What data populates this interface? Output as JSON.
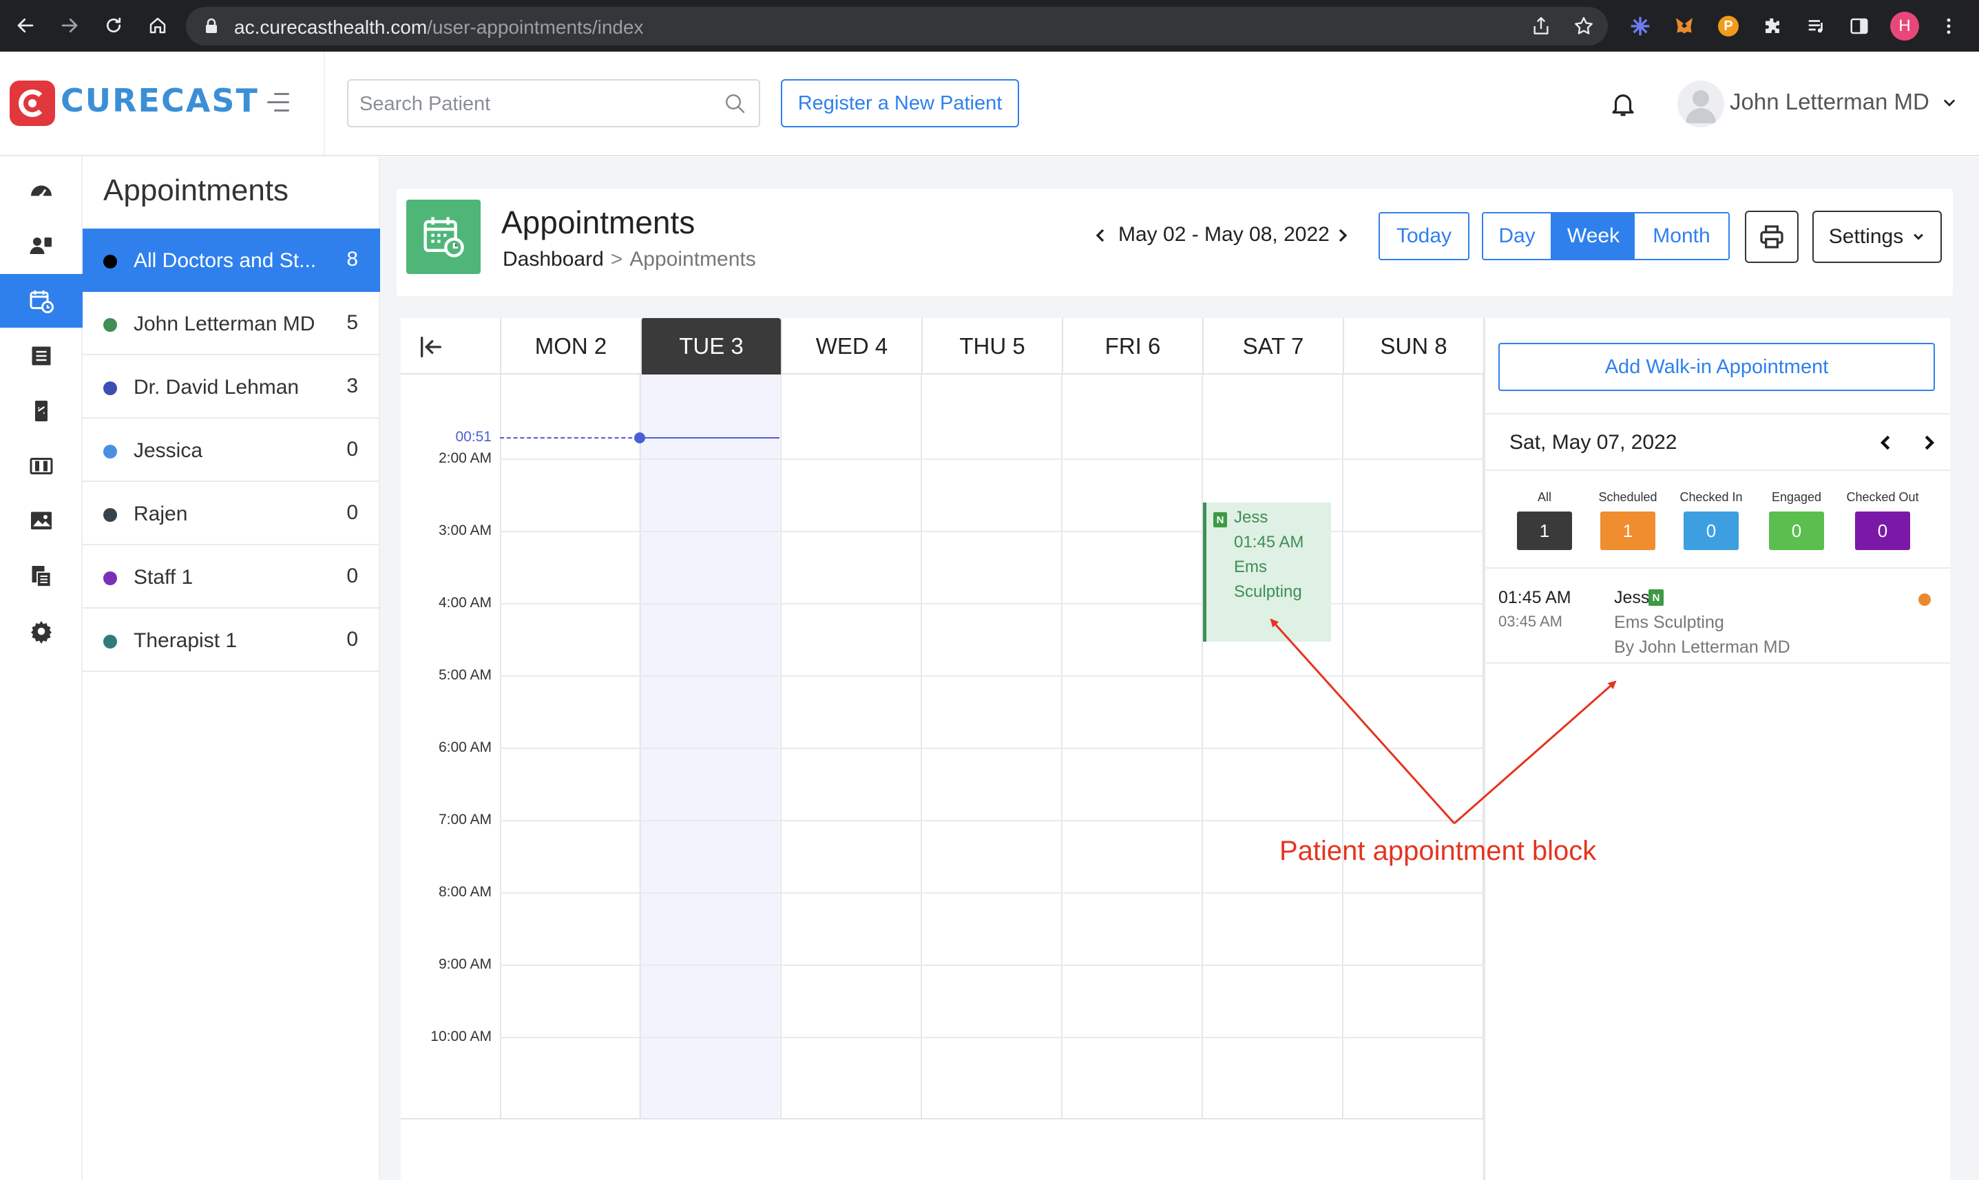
{
  "browser": {
    "url_domain": "ac.curecasthealth.com",
    "url_path": "/user-appointments/index",
    "profile_initial": "H"
  },
  "header": {
    "logo_text": "CURECAST",
    "search_placeholder": "Search Patient",
    "register_label": "Register a New Patient",
    "user_name": "John Letterman MD"
  },
  "sidebar_icons": [
    "dashboard-icon",
    "patients-icon",
    "appointments-icon",
    "records-icon",
    "billing-icon",
    "library-icon",
    "gallery-icon",
    "reports-icon",
    "settings-icon"
  ],
  "doctors": {
    "title": "Appointments",
    "items": [
      {
        "name": "All Doctors and St...",
        "count": "8",
        "color": "#000000"
      },
      {
        "name": "John Letterman MD",
        "count": "5",
        "color": "#3e8e56"
      },
      {
        "name": "Dr. David Lehman",
        "count": "3",
        "color": "#3c4fb0"
      },
      {
        "name": "Jessica",
        "count": "0",
        "color": "#4a90e2"
      },
      {
        "name": "Rajen",
        "count": "0",
        "color": "#37424b"
      },
      {
        "name": "Staff 1",
        "count": "0",
        "color": "#7b2fb8"
      },
      {
        "name": "Therapist 1",
        "count": "0",
        "color": "#2f7d7a"
      }
    ]
  },
  "page": {
    "title": "Appointments",
    "breadcrumb": [
      "Dashboard",
      ">",
      "Appointments"
    ],
    "date_range": "May 02 - May 08, 2022",
    "today_label": "Today",
    "views": {
      "day": "Day",
      "week": "Week",
      "month": "Month",
      "active": "week"
    },
    "settings_label": "Settings"
  },
  "calendar": {
    "days": [
      "MON 2",
      "TUE 3",
      "WED 4",
      "THU 5",
      "FRI 6",
      "SAT 7",
      "SUN 8"
    ],
    "today_index": 1,
    "now_label": "00:51",
    "time_labels": [
      "2:00 AM",
      "3:00 AM",
      "4:00 AM",
      "5:00 AM",
      "6:00 AM",
      "7:00 AM",
      "8:00 AM",
      "9:00 AM",
      "10:00 AM"
    ],
    "appointment": {
      "badge": "N",
      "patient": "Jess",
      "time": "01:45 AM",
      "service_line1": "Ems",
      "service_line2": "Sculpting",
      "day_index": 5
    }
  },
  "annotation": {
    "text": "Patient appointment block",
    "color": "#e4341f"
  },
  "right_panel": {
    "walkin_label": "Add Walk-in Appointment",
    "date": "Sat, May 07, 2022",
    "stats": [
      {
        "label": "All",
        "value": "1",
        "color": "#3a3a3a"
      },
      {
        "label": "Scheduled",
        "value": "1",
        "color": "#ef8d2f"
      },
      {
        "label": "Checked In",
        "value": "0",
        "color": "#3d9fe0"
      },
      {
        "label": "Engaged",
        "value": "0",
        "color": "#5bbf4f"
      },
      {
        "label": "Checked Out",
        "value": "0",
        "color": "#7a19a8"
      }
    ],
    "appointment": {
      "start": "01:45 AM",
      "end": "03:45 AM",
      "patient": "Jess",
      "badge": "N",
      "service": "Ems Sculpting",
      "by": "By John Letterman MD",
      "status_color": "#ea8a2e"
    }
  }
}
